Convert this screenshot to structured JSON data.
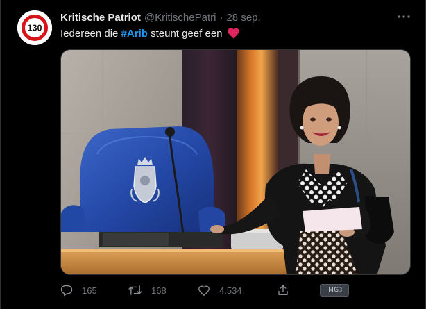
{
  "author": {
    "name": "Kritische Patriot",
    "handle": "@KritischePatri",
    "separator": "·",
    "date": "28 sep.",
    "avatar_sign_text": "130",
    "avatar_icon": "speed-limit-sign"
  },
  "tweet": {
    "text_before": "Iedereen die ",
    "hashtag": "#Arib",
    "text_after": " steunt geef een",
    "emoji": "red-heart"
  },
  "media": {
    "kind": "photo",
    "seat_emblem_icon": "royal-coat-of-arms"
  },
  "actions": {
    "replies": "165",
    "retweets": "168",
    "likes": "4.534"
  },
  "img_badge": {
    "label": "IMG",
    "count": "3"
  },
  "colors": {
    "background": "#000000",
    "text": "#e7e9ea",
    "muted": "#71767b",
    "hashtag": "#1d9bf0",
    "heart": "#f91880"
  }
}
